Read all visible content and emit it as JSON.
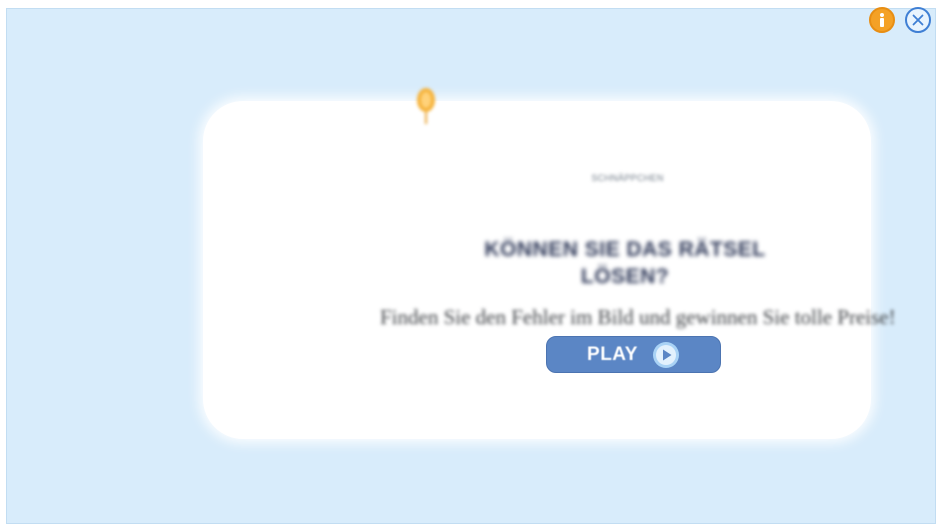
{
  "ad": {
    "kicker": "SCHNÄPPCHEN",
    "title": "KÖNNEN SIE DAS RÄTSEL\nLÖSEN?",
    "subtitle": "Finden Sie den Fehler im Bild und gewinnen Sie tolle Preise!",
    "play_label": "PLAY"
  },
  "icons": {
    "info": "info-icon",
    "close": "close-icon",
    "play": "play-circle-icon",
    "pin": "pin-icon"
  },
  "colors": {
    "background": "#d8ecfb",
    "card": "#ffffff",
    "play_button": "#5b86c5",
    "info_button": "#f4a126",
    "close_border": "#3f7fd4",
    "title_text": "#2e3858"
  }
}
